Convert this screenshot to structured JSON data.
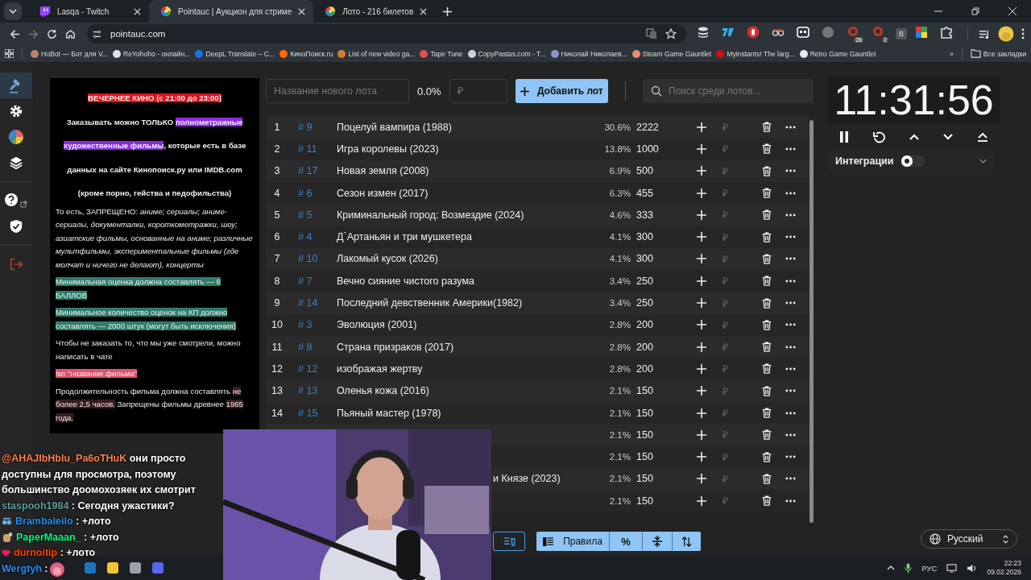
{
  "browser": {
    "tabs": [
      {
        "title": "Lasqa - Twitch",
        "kind": "twitch",
        "selected": false
      },
      {
        "title": "Pointauc | Аукцион для стриме",
        "kind": "wheel",
        "selected": true
      },
      {
        "title": "Лото - 216 билетов",
        "kind": "wheel",
        "selected": false
      }
    ],
    "address": "pointauc.com",
    "extensions": [
      {
        "kind": "stack"
      },
      {
        "kind": "bolt"
      },
      {
        "kind": "hand"
      },
      {
        "kind": "glasses"
      },
      {
        "kind": "face"
      },
      {
        "kind": "dot"
      },
      {
        "kind": "bubble",
        "badge": "28"
      },
      {
        "kind": "bubble",
        "badge": "2"
      },
      {
        "kind": "letter",
        "label": "B"
      },
      {
        "kind": "palette"
      },
      {
        "kind": "puzzle"
      }
    ],
    "bookmarks": [
      {
        "label": "HoBot — Бот для V...",
        "color": "#c08070"
      },
      {
        "label": "ReYohoho - онлайн...",
        "color": "#e0e0e0"
      },
      {
        "label": "DeepL Translate – C...",
        "color": "#1a73e8"
      },
      {
        "label": "КиноПоиск.ru",
        "color": "#ff6a00"
      },
      {
        "label": "List of new video ga...",
        "color": "#d08030"
      },
      {
        "label": "Tape Tune",
        "color": "#e05050"
      },
      {
        "label": "CopyPastas.com - T...",
        "color": "#d0d0d0"
      },
      {
        "label": "Николай Николаев...",
        "color": "#9090d0"
      },
      {
        "label": "Steam Game Gauntlet",
        "color": "#e09070"
      },
      {
        "label": "Myinstants! The larg...",
        "color": "#cc1111"
      },
      {
        "label": "Retro Game Gauntlet",
        "color": "#e8e8e8"
      }
    ],
    "more_bookmarks": "»",
    "all_bookmarks": "Все закладки"
  },
  "sidebar": {
    "items": [
      {
        "kind": "gavel",
        "selected": true
      },
      {
        "kind": "gear",
        "selected": false
      },
      {
        "kind": "pie",
        "selected": false
      },
      {
        "kind": "layers",
        "selected": false
      },
      {
        "kind": "help",
        "selected": false
      },
      {
        "kind": "shield",
        "selected": false
      },
      {
        "kind": "logout",
        "selected": false
      }
    ]
  },
  "rules": [
    {
      "bold": true,
      "segments": [
        {
          "text": "ВЕЧЕРНЕЕ КИНО (с 21:00 до 23:00)",
          "color": "#e0101a"
        }
      ]
    },
    {
      "bold": true,
      "segments": [
        {
          "text": "Заказывать можно ТОЛЬКО "
        },
        {
          "text": "полнометражные художественные фильмы",
          "color": "#8a2be2"
        },
        {
          "text": ", которые есть в базе данных на сайте Кинопоиск.ру или IMDB.com"
        }
      ]
    },
    {
      "bold": true,
      "segments": [
        {
          "text": "(кроме порно, гейства и педофильства)"
        }
      ]
    },
    {
      "bold": false,
      "segments": [
        {
          "text": "То есть, ЗАПРЕЩЕНО: "
        },
        {
          "text": "аниме; сериалы; аниме-сериалы, документалки, короткометражки, шоу; азиатские фильмы, основанные на аниме; различные мультфильмы, экспериментальные фильмы (где молчат и ничего не делают), концерты",
          "italic": true
        }
      ]
    },
    {
      "bold": false,
      "segments": [
        {
          "text": "Минимальная оценка должна составлять — 6 БАЛЛОВ",
          "color": "#2f7c6a"
        }
      ]
    },
    {
      "bold": false,
      "segments": [
        {
          "text": "Минимальное количество оценок на КП должно составлять — 2000 штук (могут быть исключения)",
          "color": "#2f7c6a"
        }
      ]
    },
    {
      "bold": false,
      "segments": [
        {
          "text": "Чтобы не заказать то, что мы уже смотрели, можно написать в чате"
        }
      ]
    },
    {
      "bold": false,
      "segments": [
        {
          "text": "!кп \"название фильма\"",
          "color": "#e0506a"
        }
      ]
    },
    {
      "bold": false,
      "segments": [
        {
          "text": "Продолжительность фильма должна составлять "
        },
        {
          "text": "не более 2,5 часов.",
          "color": "#3a1c1e"
        },
        {
          "text": " Запрещены фильмы древнее "
        },
        {
          "text": "1965 года.",
          "color": "#3a1c1e"
        }
      ]
    }
  ],
  "lot_form": {
    "name_placeholder": "Название нового лота",
    "percent": "0.0%",
    "amount_placeholder": "₽",
    "add_button": "Добавить лот",
    "search_placeholder": "Поиск среди лотов..."
  },
  "lots": [
    {
      "num": "1",
      "id": "# 9",
      "title": "Поцелуй вампира (1988)",
      "percent": "30.6%",
      "amount": "2222",
      "currency": "₽"
    },
    {
      "num": "2",
      "id": "# 11",
      "title": "Игра королевы (2023)",
      "percent": "13.8%",
      "amount": "1000",
      "currency": "₽"
    },
    {
      "num": "3",
      "id": "# 17",
      "title": "Новая земля (2008)",
      "percent": "6.9%",
      "amount": "500",
      "currency": "₽"
    },
    {
      "num": "4",
      "id": "# 6",
      "title": "Сезон измен (2017)",
      "percent": "6.3%",
      "amount": "455",
      "currency": "₽"
    },
    {
      "num": "5",
      "id": "# 5",
      "title": "Криминальный город: Возмездие (2024)",
      "percent": "4.6%",
      "amount": "333",
      "currency": "₽"
    },
    {
      "num": "6",
      "id": "# 4",
      "title": "Д`Артаньян и три мушкетера",
      "percent": "4.1%",
      "amount": "300",
      "currency": "₽"
    },
    {
      "num": "7",
      "id": "# 10",
      "title": "Лакомый кусок (2026)",
      "percent": "4.1%",
      "amount": "300",
      "currency": "₽"
    },
    {
      "num": "8",
      "id": "# 7",
      "title": "Вечно сияние чистого разума",
      "percent": "3.4%",
      "amount": "250",
      "currency": "₽"
    },
    {
      "num": "9",
      "id": "# 14",
      "title": "Последний девственник Америки(1982)",
      "percent": "3.4%",
      "amount": "250",
      "currency": "₽"
    },
    {
      "num": "10",
      "id": "# 3",
      "title": "Эволюция (2001)",
      "percent": "2.8%",
      "amount": "200",
      "currency": "₽"
    },
    {
      "num": "11",
      "id": "# 8",
      "title": "Страна призраков (2017)",
      "percent": "2.8%",
      "amount": "200",
      "currency": "₽"
    },
    {
      "num": "12",
      "id": "# 12",
      "title": "изображая жертву",
      "percent": "2.8%",
      "amount": "200",
      "currency": "₽"
    },
    {
      "num": "13",
      "id": "# 13",
      "title": "Оленья кожа (2016)",
      "percent": "2.1%",
      "amount": "150",
      "currency": "₽"
    },
    {
      "num": "14",
      "id": "# 15",
      "title": "Пьяный мастер (1978)",
      "percent": "2.1%",
      "amount": "150",
      "currency": "₽"
    },
    {
      "percent": "2.1%",
      "amount": "150",
      "currency": "₽"
    },
    {
      "percent": "2.1%",
      "amount": "150",
      "currency": "₽"
    },
    {
      "title_tail": "и Князе (2023)",
      "percent": "2.1%",
      "amount": "150",
      "currency": "₽"
    },
    {
      "percent": "2.1%",
      "amount": "150",
      "currency": "₽"
    }
  ],
  "bottom_toolbar": {
    "rules_button": "Правила",
    "percent_button": "%"
  },
  "timer": {
    "time": "11:31:56"
  },
  "integrations": {
    "label": "Интеграции",
    "on": false
  },
  "language": "Русский",
  "stream_overlay": {
    "chat": [
      {
        "kind": "plain",
        "user": "@AHAJIbHblu_Pa6oTHuK",
        "color": "#ff7f50",
        "text": "они просто доступны для просмотра, поэтому большинство доомохозяек их смотрит"
      },
      {
        "kind": "plain",
        "user": "staspooh1984",
        "color": "#5f9ea0",
        "text": ": Сегодня ужастики?"
      },
      {
        "kind": "glasses",
        "user": "Brambaleilo",
        "color": "#1e90ff",
        "text": ": +лото"
      },
      {
        "kind": "hand",
        "user": "PaperMaaan_",
        "color": "#00ff7f",
        "text": ": +лото"
      },
      {
        "kind": "heart",
        "user": "durnoitip",
        "color": "#ff4500",
        "text": ": +лото"
      },
      {
        "kind": "emote",
        "user": "Wergtyh",
        "color": "#1e90ff",
        "text": ":"
      }
    ]
  },
  "taskbar": {
    "apps": [
      {
        "color": "#1b75bc"
      },
      {
        "color": "#f4c430"
      },
      {
        "color": "#9aa0a6"
      },
      {
        "color": "#5865f2"
      }
    ],
    "language": "РУС",
    "time": "22:23",
    "date": "09.02.2026"
  }
}
